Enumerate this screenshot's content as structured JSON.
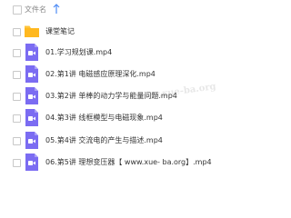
{
  "header": {
    "name_column": "文件名"
  },
  "files": [
    {
      "name": "课堂笔记",
      "type": "folder"
    },
    {
      "name": "01.学习规划课.mp4",
      "type": "video"
    },
    {
      "name": "02.第1讲 电磁感应原理深化.mp4",
      "type": "video"
    },
    {
      "name": "03.第2讲 单棒的动力学与能量问题.mp4",
      "type": "video"
    },
    {
      "name": "04.第3讲 线框模型与电磁现象.mp4",
      "type": "video"
    },
    {
      "name": "05.第4讲 交流电的产生与描述.mp4",
      "type": "video"
    },
    {
      "name": "06.第5讲 理想变压器【 www.xue- ba.org】.mp4",
      "type": "video"
    }
  ],
  "watermark": "www.xue-ba.org",
  "colors": {
    "folder": "#ffc43a",
    "video": "#7b6cf2",
    "sort_arrow": "#4e8cf5"
  }
}
